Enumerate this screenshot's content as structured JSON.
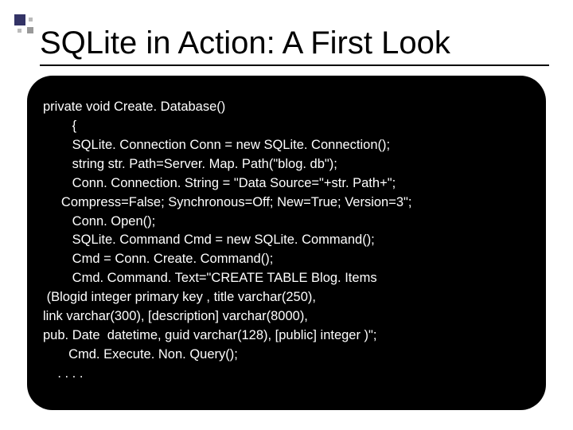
{
  "slide": {
    "title": "SQLite in Action:  A First Look"
  },
  "code": {
    "l1": "private void Create. Database()",
    "l2": "        {",
    "l3": "        SQLite. Connection Conn = new SQLite. Connection();",
    "l4": "        string str. Path=Server. Map. Path(\"blog. db\");",
    "l5": "        Conn. Connection. String = \"Data Source=\"+str. Path+\";",
    "l6": "     Compress=False; Synchronous=Off; New=True; Version=3\";",
    "l7": "        Conn. Open();",
    "l8": "        SQLite. Command Cmd = new SQLite. Command();",
    "l9": "        Cmd = Conn. Create. Command();",
    "l10": "        Cmd. Command. Text=\"CREATE TABLE Blog. Items",
    "l11": " (Blogid integer primary key , title varchar(250),",
    "l12": "link varchar(300), [description] varchar(8000),",
    "l13": "pub. Date  datetime, guid varchar(128), [public] integer )\";",
    "l14": "       Cmd. Execute. Non. Query();",
    "l15": "    . . . ."
  }
}
